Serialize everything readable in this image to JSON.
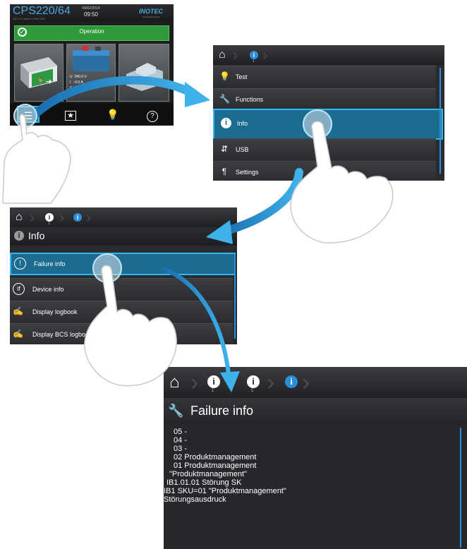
{
  "screen1": {
    "model": "CPS220/64",
    "firmware": "V3.1.11 netur0.1 Hex-Sdc",
    "date": "09/02/2014",
    "time": "09:50",
    "brand": "INOTEC",
    "brand_sub": "Sicherheitstechnik",
    "status": "Operation",
    "battery": {
      "u_label": "U",
      "u_value": "240.0",
      "u_unit": "V",
      "i_label": "I",
      "i_value": "-0.0",
      "i_unit": "A",
      "c_label": "C"
    },
    "status_color": "#2f9a3a"
  },
  "screen2": {
    "menu": [
      {
        "label": "Test",
        "icon": "lightbulb-icon"
      },
      {
        "label": "Functions",
        "icon": "wrench-icon"
      },
      {
        "label": "Info",
        "icon": "info-icon",
        "selected": true
      },
      {
        "label": "USB",
        "icon": "usb-icon"
      },
      {
        "label": "Settings",
        "icon": "settings-icon"
      }
    ],
    "breadcrumb_index": "1"
  },
  "screen3": {
    "title": "Info",
    "breadcrumb_index": "1",
    "menu": [
      {
        "label": "Failure info",
        "icon": "exclamation-icon",
        "selected": true
      },
      {
        "label": "Device info",
        "icon": "device-info-icon"
      },
      {
        "label": "Display logbook",
        "icon": "logbook-icon"
      },
      {
        "label": "Display BCS logbook",
        "icon": "logbook-icon"
      }
    ]
  },
  "screen4": {
    "title": "Failure info",
    "breadcrumb_index_1": "1",
    "breadcrumb_index_2": "1",
    "log_lines": [
      "05 -",
      "04 -",
      "03 -",
      "02 Produktmanagement",
      "01 Produktmanagement",
      "\"Produktmanagement\"",
      "IB1.01.01 Störung SK",
      "IB1 SKU=01  \"Produktmanagement\"",
      "Störungsausdruck"
    ]
  },
  "accent_color": "#2a8fd8",
  "selection_color": "#32b7ef"
}
